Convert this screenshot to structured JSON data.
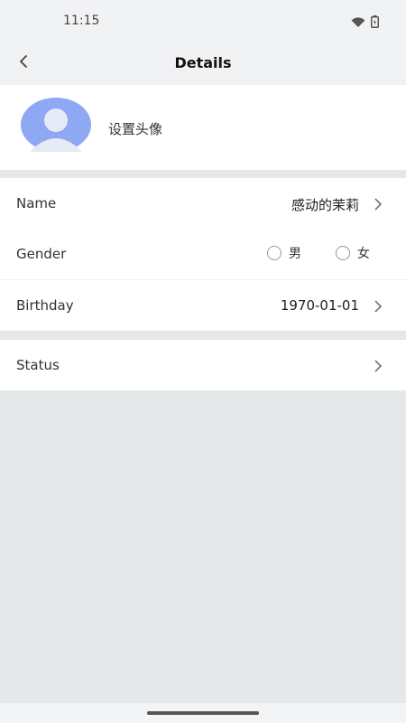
{
  "status_bar": {
    "time": "11:15",
    "icons": [
      "wifi-icon",
      "battery-charging-icon"
    ]
  },
  "header": {
    "title": "Details",
    "back_icon": "back-arrow-icon"
  },
  "avatar": {
    "label": "设置头像",
    "icon": "avatar-placeholder-icon",
    "color": "#8fa8f3"
  },
  "fields": {
    "name": {
      "label": "Name",
      "value": "感动的茉莉"
    },
    "gender": {
      "label": "Gender",
      "options": [
        "男",
        "女"
      ]
    },
    "birthday": {
      "label": "Birthday",
      "value": "1970-01-01"
    },
    "status": {
      "label": "Status"
    }
  },
  "colors": {
    "background": "#e5e8e8",
    "header": "#f1f2f4",
    "surface": "#ffffff"
  }
}
